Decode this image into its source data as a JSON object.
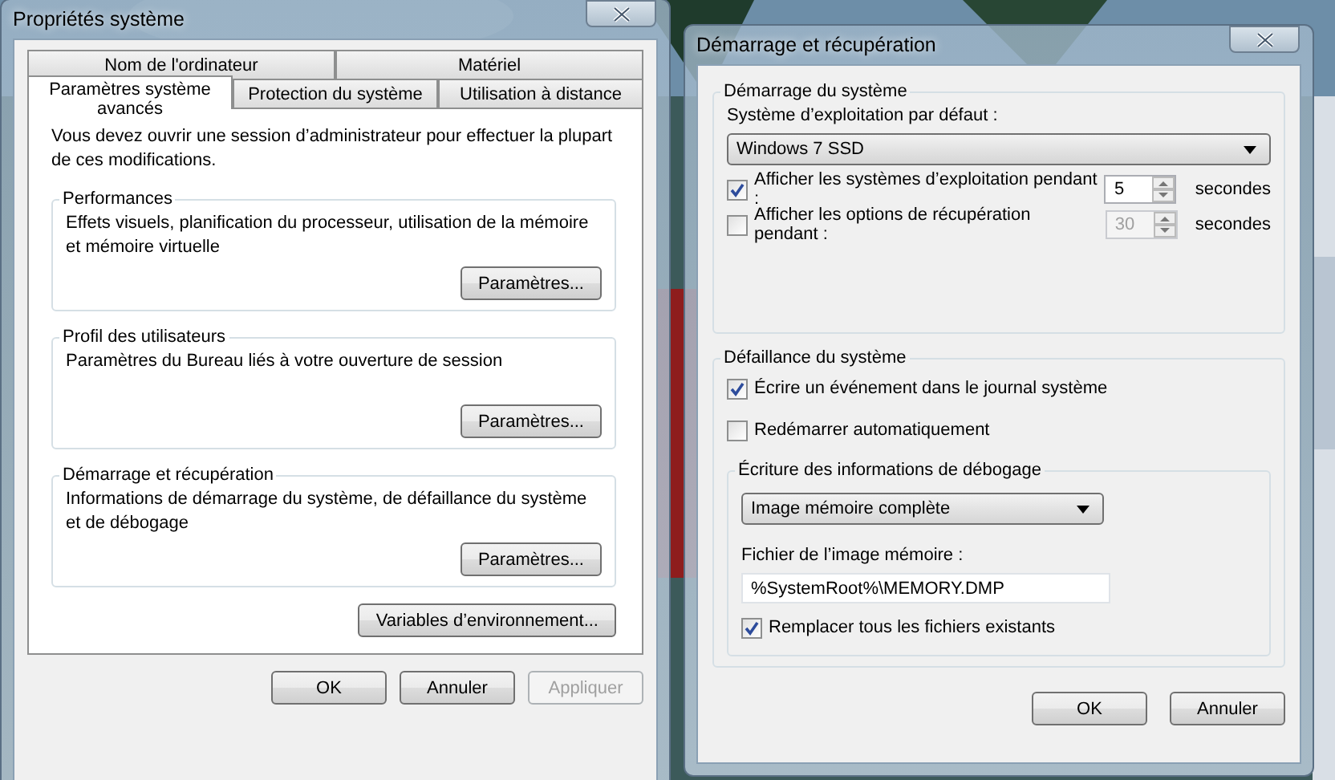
{
  "system_properties": {
    "title": "Propriétés système",
    "tab_rows": [
      {
        "tabs": [
          {
            "label": "Nom de l'ordinateur",
            "selected": false
          },
          {
            "label": "Matériel",
            "selected": false
          }
        ]
      },
      {
        "tabs": [
          {
            "label": "Paramètres système avancés",
            "selected": true
          },
          {
            "label": "Protection du système",
            "selected": false
          },
          {
            "label": "Utilisation à distance",
            "selected": false
          }
        ]
      }
    ],
    "intro": "Vous devez ouvrir une session d’administrateur pour effectuer la plupart de ces modifications.",
    "groups": [
      {
        "title": "Performances",
        "description": "Effets visuels, planification du processeur, utilisation de la mémoire et mémoire virtuelle",
        "button": "Paramètres..."
      },
      {
        "title": "Profil des utilisateurs",
        "description": "Paramètres du Bureau liés à votre ouverture de session",
        "button": "Paramètres..."
      },
      {
        "title": "Démarrage et récupération",
        "description": "Informations de démarrage du système, de défaillance du système et de débogage",
        "button": "Paramètres..."
      }
    ],
    "environment_button": "Variables d’environnement...",
    "buttons": [
      {
        "label": "OK",
        "disabled": false
      },
      {
        "label": "Annuler",
        "disabled": false
      },
      {
        "label": "Appliquer",
        "disabled": true
      }
    ]
  },
  "startup_recovery": {
    "title": "Démarrage et récupération",
    "startup_group": {
      "title": "Démarrage du système",
      "default_os_label": "Système d’exploitation par défaut :",
      "default_os": "Windows 7 SSD",
      "options": [
        {
          "label": "Afficher les systèmes d’exploitation pendant :",
          "checked": true,
          "value": "5",
          "unit": "secondes"
        },
        {
          "label": "Afficher les options de récupération pendant :",
          "checked": false,
          "value": "30",
          "unit": "secondes"
        }
      ]
    },
    "failure_group": {
      "title": "Défaillance du système",
      "checks": [
        {
          "label": "Écrire un événement dans le journal système",
          "checked": true
        },
        {
          "label": "Redémarrer automatiquement",
          "checked": false
        }
      ],
      "debug_group": {
        "title": "Écriture des informations de débogage",
        "dump_type": "Image mémoire complète",
        "file_label": "Fichier de l’image mémoire :",
        "file": "%SystemRoot%\\MEMORY.DMP",
        "overwrite": {
          "label": "Remplacer tous les fichiers existants",
          "checked": true
        }
      }
    },
    "buttons": [
      {
        "label": "OK",
        "disabled": false
      },
      {
        "label": "Annuler",
        "disabled": false
      }
    ]
  }
}
